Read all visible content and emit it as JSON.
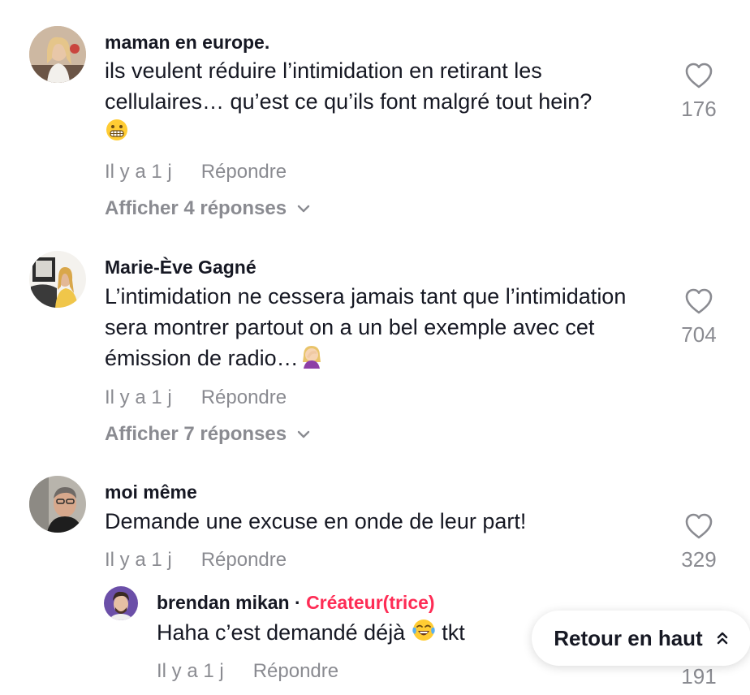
{
  "comments": [
    {
      "username": "maman en europe.",
      "text": "ils veulent réduire l’intimidation en retirant les cellulaires… qu’est ce qu’ils font malgré tout hein?",
      "emoji": "grimace",
      "time": "Il y a 1 j",
      "reply_label": "Répondre",
      "show_replies": "Afficher 4 réponses",
      "likes": "176"
    },
    {
      "username": "Marie-Ève Gagné",
      "text": "L’intimidation ne cessera jamais tant que l’intimidation sera montrer partout on a un bel exemple avec cet émission de radio…",
      "emoji": "facepalm",
      "time": "Il y a 1 j",
      "reply_label": "Répondre",
      "show_replies": "Afficher 7 réponses",
      "likes": "704"
    },
    {
      "username": "moi même",
      "text": "Demande une excuse en onde de leur part!",
      "time": "Il y a 1 j",
      "reply_label": "Répondre",
      "likes": "329"
    }
  ],
  "reply": {
    "username": "brendan mikan",
    "separator": "·",
    "creator_badge": "Créateur(trice)",
    "text": "Haha c’est demandé déjà",
    "text_after": "tkt",
    "emoji": "laughing-tears",
    "time": "Il y a 1 j",
    "reply_label": "Répondre",
    "likes_partial": "191"
  },
  "back_to_top": {
    "label": "Retour en haut",
    "icon": "double-chevron-up-icon"
  },
  "colors": {
    "text": "#161823",
    "muted": "#8a8b91",
    "creator": "#fe2c55"
  }
}
